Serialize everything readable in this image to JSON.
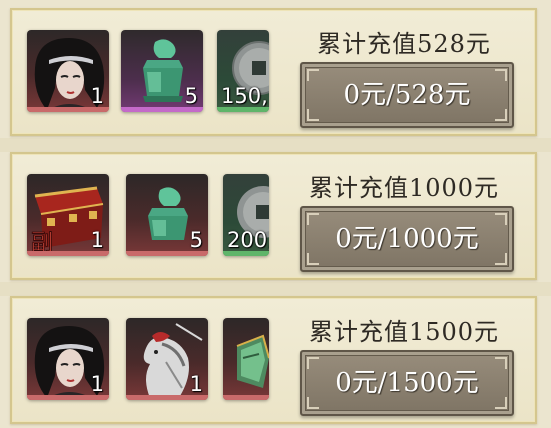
{
  "tiers": [
    {
      "title": "累计充值528元",
      "progress": "0元/528元",
      "rewards": [
        {
          "icon": "hero-portrait-icon",
          "quantity": "1",
          "quality": "red"
        },
        {
          "icon": "jade-seal-icon",
          "quantity": "5",
          "quality": "purple"
        },
        {
          "icon": "copper-coin-icon",
          "quantity": "150,",
          "quality": "green"
        }
      ]
    },
    {
      "title": "累计充值1000元",
      "progress": "0元/1000元",
      "rewards": [
        {
          "icon": "red-chest-icon",
          "quantity": "1",
          "quality": "red",
          "tag": "副"
        },
        {
          "icon": "jade-seal-icon",
          "quantity": "5",
          "quality": "red"
        },
        {
          "icon": "copper-coin-icon",
          "quantity": "200,",
          "quality": "green"
        }
      ]
    },
    {
      "title": "累计充值1500元",
      "progress": "0元/1500元",
      "rewards": [
        {
          "icon": "hero-portrait-icon",
          "quantity": "1",
          "quality": "red"
        },
        {
          "icon": "white-horse-icon",
          "quantity": "1",
          "quality": "red"
        },
        {
          "icon": "jade-talisman-icon",
          "quantity": "",
          "quality": "red"
        }
      ]
    }
  ]
}
